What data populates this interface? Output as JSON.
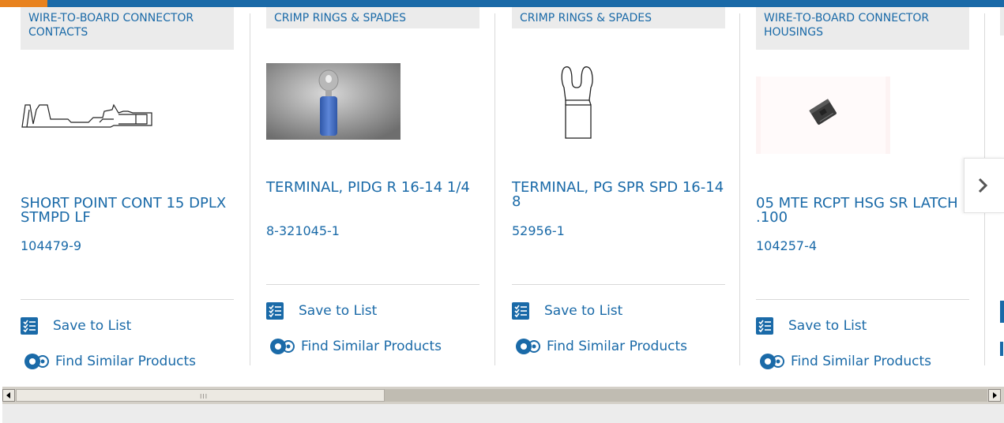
{
  "colors": {
    "brand_blue": "#1a6aa8",
    "accent_orange": "#e8821e",
    "category_bg": "#ebebeb",
    "divider": "#d9d9d9"
  },
  "cards": [
    {
      "category": "WIRE-TO-BOARD CONNECTOR CONTACTS",
      "name": "SHORT POINT CONT 15 DPLX STMPD LF",
      "part_number": "104479-9",
      "save_label": "Save to List",
      "similar_label": "Find Similar Products",
      "image": "contact-line-drawing"
    },
    {
      "category": "CRIMP RINGS & SPADES",
      "name": "TERMINAL, PIDG R 16-14 1/4",
      "part_number": "8-321045-1",
      "save_label": "Save to List",
      "similar_label": "Find Similar Products",
      "image": "blue-ring-terminal-photo"
    },
    {
      "category": "CRIMP RINGS & SPADES",
      "name": "TERMINAL, PG SPR SPD 16-14 8",
      "part_number": "52956-1",
      "save_label": "Save to List",
      "similar_label": "Find Similar Products",
      "image": "spade-terminal-line-drawing"
    },
    {
      "category": "WIRE-TO-BOARD CONNECTOR HOUSINGS",
      "name": "05 MTE RCPT HSG SR LATCH .100",
      "part_number": "104257-4",
      "save_label": "Save to List",
      "similar_label": "Find Similar Products",
      "image": "connector-housing-photo"
    }
  ],
  "carousel": {
    "next_icon": "chevron-right-icon"
  },
  "scrollbar": {
    "left_icon": "triangle-left-icon",
    "right_icon": "triangle-right-icon",
    "grip": "III"
  }
}
